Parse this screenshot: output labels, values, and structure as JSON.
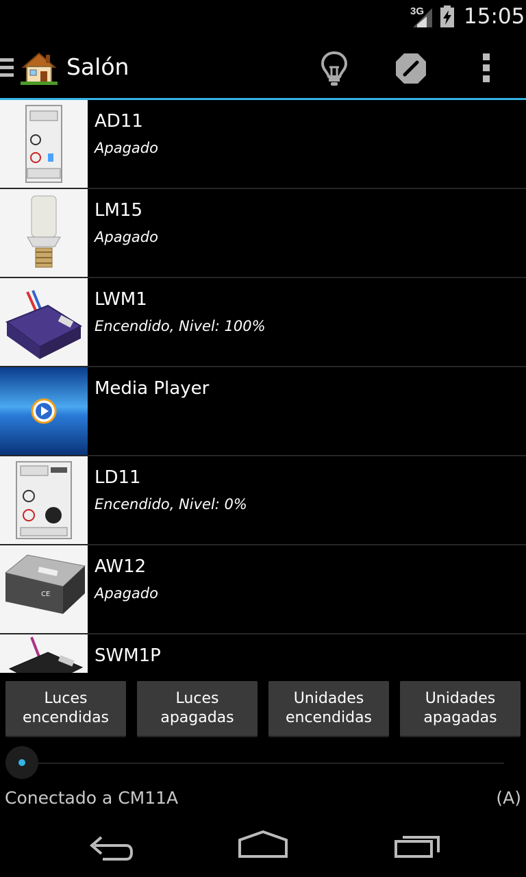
{
  "status_bar": {
    "network": "3G",
    "time": "15:05",
    "icons": [
      "signal-3g-icon",
      "battery-charging-icon"
    ]
  },
  "action_bar": {
    "title": "Salón",
    "icons": [
      "drawer-icon",
      "house-icon",
      "light-bulb-icon",
      "forbid-icon",
      "overflow-menu-icon"
    ]
  },
  "devices": [
    {
      "name": "AD11",
      "state": "Apagado",
      "image": "din-dimmer-module"
    },
    {
      "name": "LM15",
      "state": "Apagado",
      "image": "lamp-socket-module"
    },
    {
      "name": "LWM1",
      "state": "Encendido, Nivel: 100%",
      "image": "micro-module-purple"
    },
    {
      "name": "Media Player",
      "state": "",
      "image": "media-player-logo"
    },
    {
      "name": "LD11",
      "state": "Encendido, Nivel: 0%",
      "image": "din-dimmer-knob"
    },
    {
      "name": "AW12",
      "state": "Apagado",
      "image": "appliance-module-grey"
    },
    {
      "name": "SWM1P",
      "state": "",
      "image": "micro-module-dark"
    }
  ],
  "buttons": {
    "lights_on": "Luces encendidas",
    "lights_off": "Luces apagadas",
    "units_on": "Unidades encendidas",
    "units_off": "Unidades apagadas"
  },
  "connection": {
    "status": "Conectado a CM11A",
    "mode": "(A)"
  },
  "nav_bar": {
    "icons": [
      "back-icon",
      "home-icon",
      "recent-apps-icon"
    ]
  },
  "colors": {
    "accent": "#33b5e5",
    "background": "#000000",
    "button": "#3a3a3a"
  }
}
